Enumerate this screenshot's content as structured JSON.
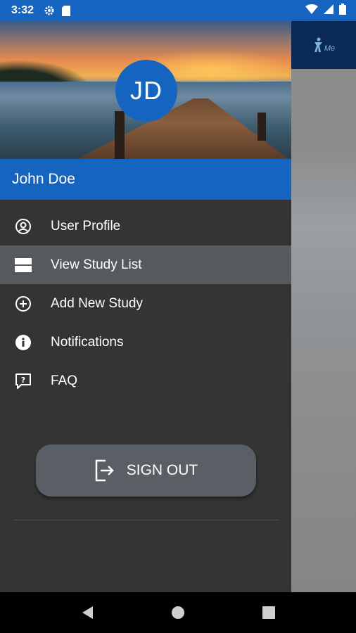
{
  "status_bar": {
    "time": "3:32",
    "icons": [
      "settings-icon",
      "sd-card-icon",
      "wifi-icon",
      "signal-icon",
      "battery-icon"
    ]
  },
  "drawer": {
    "avatar_initials": "JD",
    "user_name": "John Doe",
    "menu": [
      {
        "label": "User Profile",
        "icon": "account-circle-icon",
        "active": false
      },
      {
        "label": "View Study List",
        "icon": "list-view-icon",
        "active": true
      },
      {
        "label": "Add New Study",
        "icon": "add-circle-icon",
        "active": false
      },
      {
        "label": "Notifications",
        "icon": "info-icon",
        "active": false
      },
      {
        "label": "FAQ",
        "icon": "help-chat-icon",
        "active": false
      }
    ],
    "sign_out_label": "SIGN OUT"
  },
  "background_app": {
    "logo_text": "Me"
  },
  "colors": {
    "primary": "#1565c0",
    "drawer_bg": "#343434",
    "active_item_bg": "#56595e",
    "signout_bg": "#5a5f66"
  },
  "nav_bar": {
    "buttons": [
      "back-icon",
      "home-icon",
      "recents-icon"
    ]
  }
}
